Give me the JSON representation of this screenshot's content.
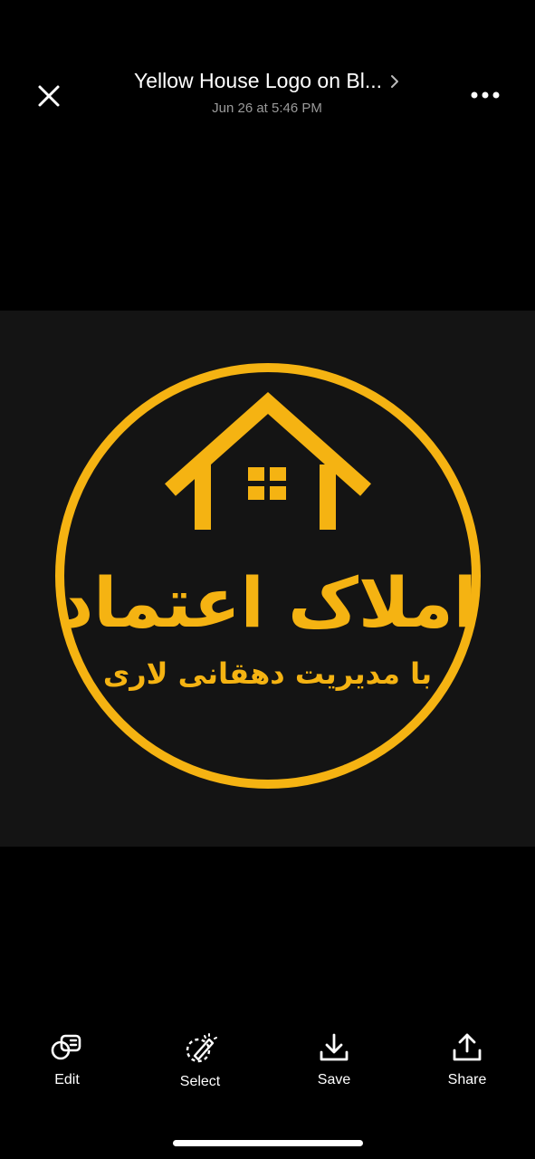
{
  "header": {
    "title": "Yellow House Logo on Bl...",
    "timestamp": "Jun 26 at 5:46 PM"
  },
  "image": {
    "brand_color": "#f5b312",
    "background": "#141414",
    "logo_title": "املاک اعتماد",
    "logo_subtitle": "با مدیریت دهقانی لاری"
  },
  "toolbar": {
    "items": [
      {
        "label": "Edit",
        "icon": "edit-icon"
      },
      {
        "label": "Select",
        "icon": "select-icon"
      },
      {
        "label": "Save",
        "icon": "save-icon"
      },
      {
        "label": "Share",
        "icon": "share-icon"
      }
    ]
  }
}
